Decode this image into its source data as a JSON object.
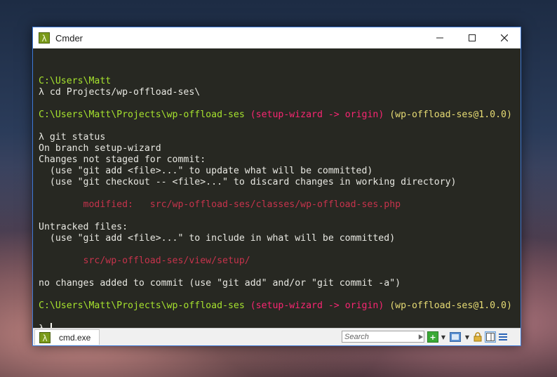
{
  "window": {
    "title": "Cmder",
    "app_icon_glyph": "λ",
    "controls": {
      "minimize": "—",
      "maximize": "☐",
      "close": "✕"
    }
  },
  "terminal": {
    "lines": [
      [],
      [
        {
          "t": "C:\\Users\\Matt",
          "c": "green"
        }
      ],
      [
        {
          "t": "λ cd Projects/wp-offload-ses\\",
          "c": ""
        }
      ],
      [],
      [
        {
          "t": "C:\\Users\\Matt\\Projects\\wp-offload-ses",
          "c": "green"
        },
        {
          "t": " ",
          "c": ""
        },
        {
          "t": "(setup-wizard -> origin)",
          "c": "red"
        },
        {
          "t": " (wp-offload-ses@1.0.0)",
          "c": "yellow"
        }
      ],
      [],
      [
        {
          "t": "λ git status",
          "c": ""
        }
      ],
      [
        {
          "t": "On branch setup-wizard",
          "c": ""
        }
      ],
      [
        {
          "t": "Changes not staged for commit:",
          "c": ""
        }
      ],
      [
        {
          "t": "  (use \"git add <file>...\" to update what will be committed)",
          "c": ""
        }
      ],
      [
        {
          "t": "  (use \"git checkout -- <file>...\" to discard changes in working directory)",
          "c": ""
        }
      ],
      [],
      [
        {
          "t": "        modified:   src/wp-offload-ses/classes/wp-offload-ses.php",
          "c": "dimred"
        }
      ],
      [],
      [
        {
          "t": "Untracked files:",
          "c": ""
        }
      ],
      [
        {
          "t": "  (use \"git add <file>...\" to include in what will be committed)",
          "c": ""
        }
      ],
      [],
      [
        {
          "t": "        src/wp-offload-ses/view/setup/",
          "c": "dimred"
        }
      ],
      [],
      [
        {
          "t": "no changes added to commit (use \"git add\" and/or \"git commit -a\")",
          "c": ""
        }
      ],
      [],
      [
        {
          "t": "C:\\Users\\Matt\\Projects\\wp-offload-ses",
          "c": "green"
        },
        {
          "t": " ",
          "c": ""
        },
        {
          "t": "(setup-wizard -> origin)",
          "c": "red"
        },
        {
          "t": " (wp-offload-ses@1.0.0)",
          "c": "yellow"
        }
      ],
      [],
      [
        {
          "t": "λ ",
          "c": ""
        }
      ]
    ],
    "colors": {
      "background": "#272822",
      "text": "#e8e8e2",
      "green": "#a6e22e",
      "red": "#f92672",
      "yellow": "#e6db74",
      "dimred": "#c7334c"
    }
  },
  "statusbar": {
    "tab_label": "cmd.exe",
    "search_placeholder": "Search"
  }
}
